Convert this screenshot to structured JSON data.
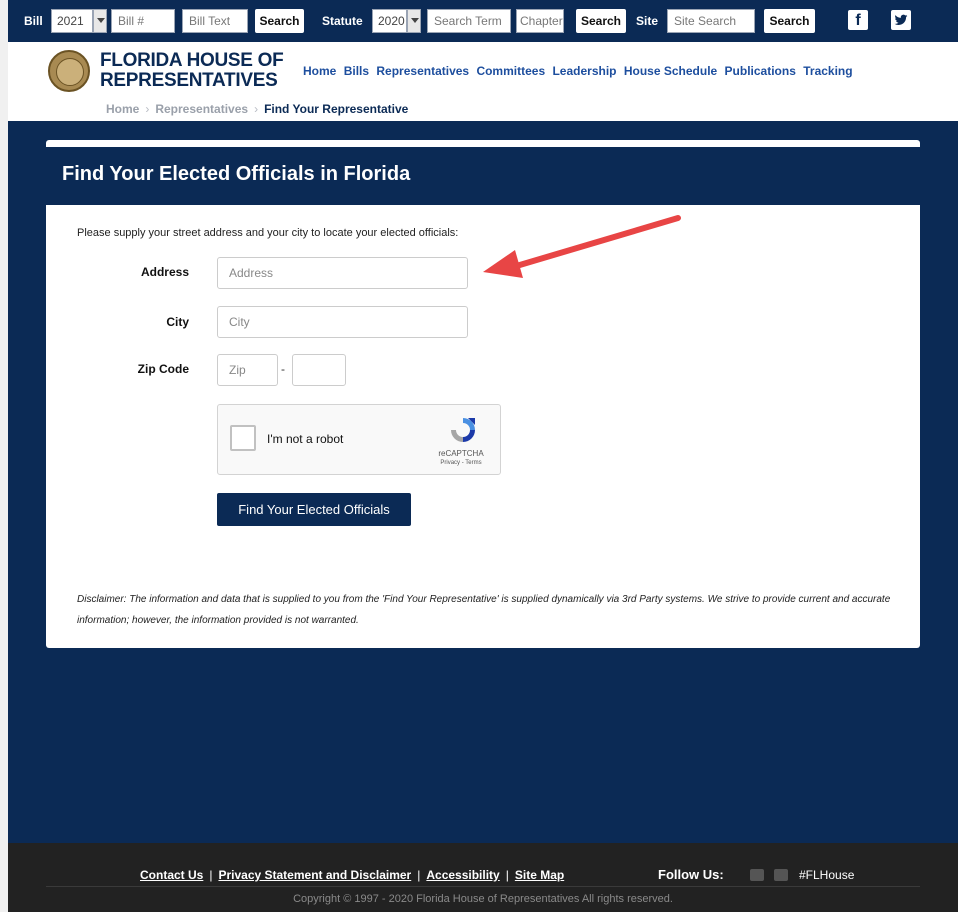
{
  "topbar": {
    "bill_label": "Bill",
    "bill_year": "2021",
    "bill_number_placeholder": "Bill #",
    "bill_text_placeholder": "Bill Text",
    "bill_search": "Search",
    "statute_label": "Statute",
    "statute_year": "2020",
    "statute_term_placeholder": "Search Term",
    "chapter_placeholder": "Chapter",
    "statute_search": "Search",
    "site_label": "Site",
    "site_placeholder": "Site Search",
    "site_search": "Search",
    "facebook_icon": "f",
    "twitter_icon": "t"
  },
  "header": {
    "logo_line1": "FLORIDA HOUSE OF",
    "logo_line2": "REPRESENTATIVES",
    "nav": [
      "Home",
      "Bills",
      "Representatives",
      "Committees",
      "Leadership",
      "House Schedule",
      "Publications",
      "Tracking"
    ],
    "breadcrumb": [
      "Home",
      "Representatives",
      "Find Your Representative"
    ],
    "breadcrumb_sep": "›"
  },
  "form": {
    "title": "Find Your Elected Officials in Florida",
    "intro": "Please supply your street address and your city to locate your elected officials:",
    "address_label": "Address",
    "address_placeholder": "Address",
    "city_label": "City",
    "city_placeholder": "City",
    "zip_label": "Zip Code",
    "zip_placeholder": "Zip",
    "zip_dash": "-",
    "captcha_label": "I'm not a robot",
    "captcha_brand": "reCAPTCHA",
    "captcha_terms": "Privacy - Terms",
    "submit": "Find Your Elected Officials",
    "disclaimer": "Disclaimer: The information and data that is supplied to you from the 'Find Your Representative' is supplied dynamically via 3rd Party systems. We strive to provide current and accurate information; however, the information provided is not warranted."
  },
  "footer": {
    "links": [
      "Contact Us",
      "Privacy Statement and Disclaimer",
      "Accessibility",
      "Site Map"
    ],
    "separator": "|",
    "follow_label": "Follow Us:",
    "hashtag": "#FLHouse",
    "copyright": "Copyright © 1997 - 2020 Florida House of Representatives All rights reserved."
  },
  "colors": {
    "navy": "#0b2a55",
    "nav_link": "#1d4e9e",
    "arrow": "#e84545"
  }
}
